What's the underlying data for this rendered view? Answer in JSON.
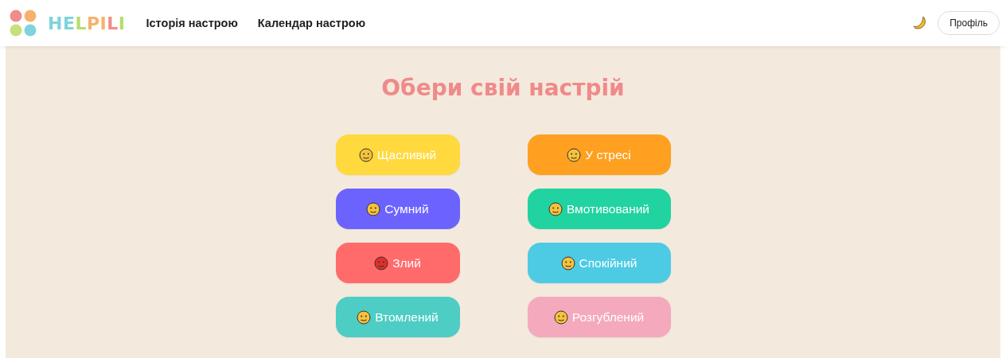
{
  "header": {
    "logo": {
      "letters": [
        {
          "char": "H",
          "color": "#7fd3dc"
        },
        {
          "char": "E",
          "color": "#7fd3dc"
        },
        {
          "char": "L",
          "color": "#b8dc6a"
        },
        {
          "char": "P",
          "color": "#f6b26b"
        },
        {
          "char": "I",
          "color": "#f6b26b"
        },
        {
          "char": "L",
          "color": "#f28b8b"
        },
        {
          "char": "I",
          "color": "#b8dc6a"
        }
      ]
    },
    "nav": [
      {
        "label": "Історія настрою"
      },
      {
        "label": "Календар настрою"
      }
    ],
    "profile_button": "Профіль"
  },
  "title": "Обери свій настрій",
  "moods": [
    {
      "label": "Щасливий",
      "color": "#ffd93d"
    },
    {
      "label": "У стресі",
      "color": "#ffa020"
    },
    {
      "label": "Сумний",
      "color": "#6c63ff"
    },
    {
      "label": "Вмотивований",
      "color": "#20d3a0"
    },
    {
      "label": "Злий",
      "color": "#ff6b6b"
    },
    {
      "label": "Спокійний",
      "color": "#4dcbe4"
    },
    {
      "label": "Втомлений",
      "color": "#4ecdc4"
    },
    {
      "label": "Розгублений",
      "color": "#f4a9bd"
    }
  ]
}
